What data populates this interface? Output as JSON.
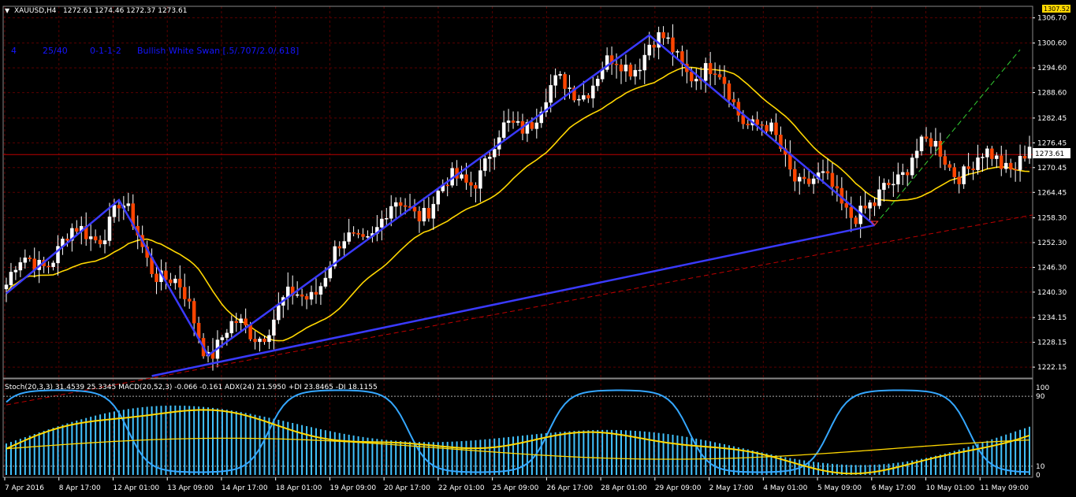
{
  "header": {
    "arrow": "▼",
    "symbol": "XAUUSD,H4",
    "ohlc": "1272.61 1274.46 1272.37 1273.61"
  },
  "pattern_info": {
    "id": "4",
    "ratio": "25/40",
    "code": "0-1-1-2",
    "name": "Bullish White Swan [.5/.707/2.0/.618]"
  },
  "indicator_header": "Stoch(20,3,3) 31.4539 25.3345 MACD(20,52,3) -0.066 -0.161  ADX(24) 21.5950 +DI 23.8465 -DI 18.1155",
  "price_tags": {
    "current": "1273.61",
    "top_marker": "1307.52"
  },
  "colors": {
    "background": "#000000",
    "grid": "#5a0000",
    "bull_candle": "#ffffff",
    "bear_candle": "#ff4500",
    "wick": "#ffffff",
    "pattern": "#3a3aff",
    "ma": "#ffd700",
    "projection": "#32cd32",
    "support": "#c00000",
    "stoch": "#35a7ff",
    "macd_hist": "#42c3ff",
    "signal": "#ffd700"
  },
  "chart_data": {
    "type": "candlestick",
    "symbol": "XAUUSD",
    "timeframe": "H4",
    "y_ticks": [
      "1306.70",
      "1300.60",
      "1294.60",
      "1288.60",
      "1282.45",
      "1276.45",
      "1270.45",
      "1264.45",
      "1258.30",
      "1252.30",
      "1246.30",
      "1240.30",
      "1234.15",
      "1228.15",
      "1222.15"
    ],
    "ylim": [
      1219.5,
      1309.5
    ],
    "x_ticks": [
      "7 Apr 2016",
      "8 Apr 17:00",
      "12 Apr 01:00",
      "13 Apr 09:00",
      "14 Apr 17:00",
      "18 Apr 01:00",
      "19 Apr 09:00",
      "20 Apr 17:00",
      "22 Apr 01:00",
      "25 Apr 09:00",
      "26 Apr 17:00",
      "28 Apr 01:00",
      "29 Apr 09:00",
      "2 May 17:00",
      "4 May 01:00",
      "5 May 09:00",
      "6 May 17:00",
      "10 May 01:00",
      "11 May 09:00"
    ],
    "current_price": 1273.61,
    "pattern_points": [
      [
        0,
        1240.0
      ],
      [
        24,
        1262.6
      ],
      [
        43,
        1225.0
      ],
      [
        137,
        1302.5
      ],
      [
        185,
        1256.5
      ]
    ],
    "support_line": [
      [
        31,
        1220.0
      ],
      [
        185,
        1256.5
      ]
    ],
    "projection_line": [
      [
        185,
        1256.5
      ],
      [
        216,
        1299.0
      ]
    ],
    "indicator_panel": {
      "levels": [
        "100",
        "90",
        "10",
        "0"
      ]
    }
  }
}
